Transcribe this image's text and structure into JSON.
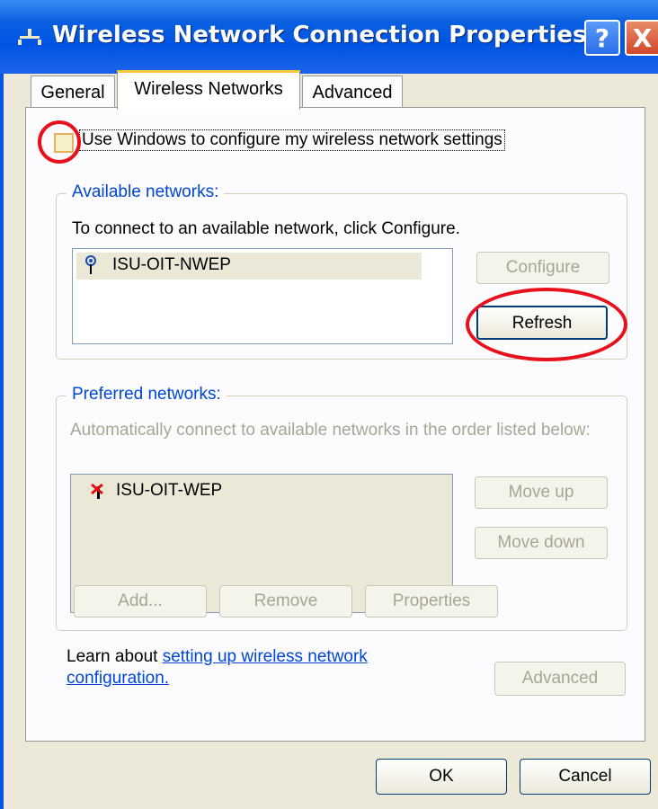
{
  "window": {
    "title": "Wireless Network Connection Properties",
    "help_glyph": "?",
    "close_glyph": "X"
  },
  "tabs": [
    {
      "label": "General"
    },
    {
      "label": "Wireless Networks"
    },
    {
      "label": "Advanced"
    }
  ],
  "settings": {
    "use_windows_label": "Use Windows to configure my wireless network settings",
    "use_windows_checked": false
  },
  "available": {
    "group_title": "Available networks:",
    "instruction": "To connect to an available network, click Configure.",
    "networks": [
      {
        "name": "ISU-OIT-NWEP",
        "icon": "wireless-antenna-icon"
      }
    ],
    "configure_label": "Configure",
    "refresh_label": "Refresh"
  },
  "preferred": {
    "group_title": "Preferred networks:",
    "instruction": "Automatically connect to available networks in the order listed below:",
    "networks": [
      {
        "name": "ISU-OIT-WEP",
        "icon": "wireless-disconnected-icon"
      }
    ],
    "move_up_label": "Move up",
    "move_down_label": "Move down",
    "add_label": "Add...",
    "remove_label": "Remove",
    "properties_label": "Properties"
  },
  "footer": {
    "learn_prefix": "Learn about ",
    "learn_link_line1": "setting up wireless network",
    "learn_link_line2": "configuration.",
    "advanced_label": "Advanced"
  },
  "dialog_buttons": {
    "ok_label": "OK",
    "cancel_label": "Cancel"
  },
  "colors": {
    "titlebar": "#0054e3",
    "dialog_bg": "#ece9d8",
    "highlight_ring": "#e8101a",
    "link": "#0046d5"
  }
}
